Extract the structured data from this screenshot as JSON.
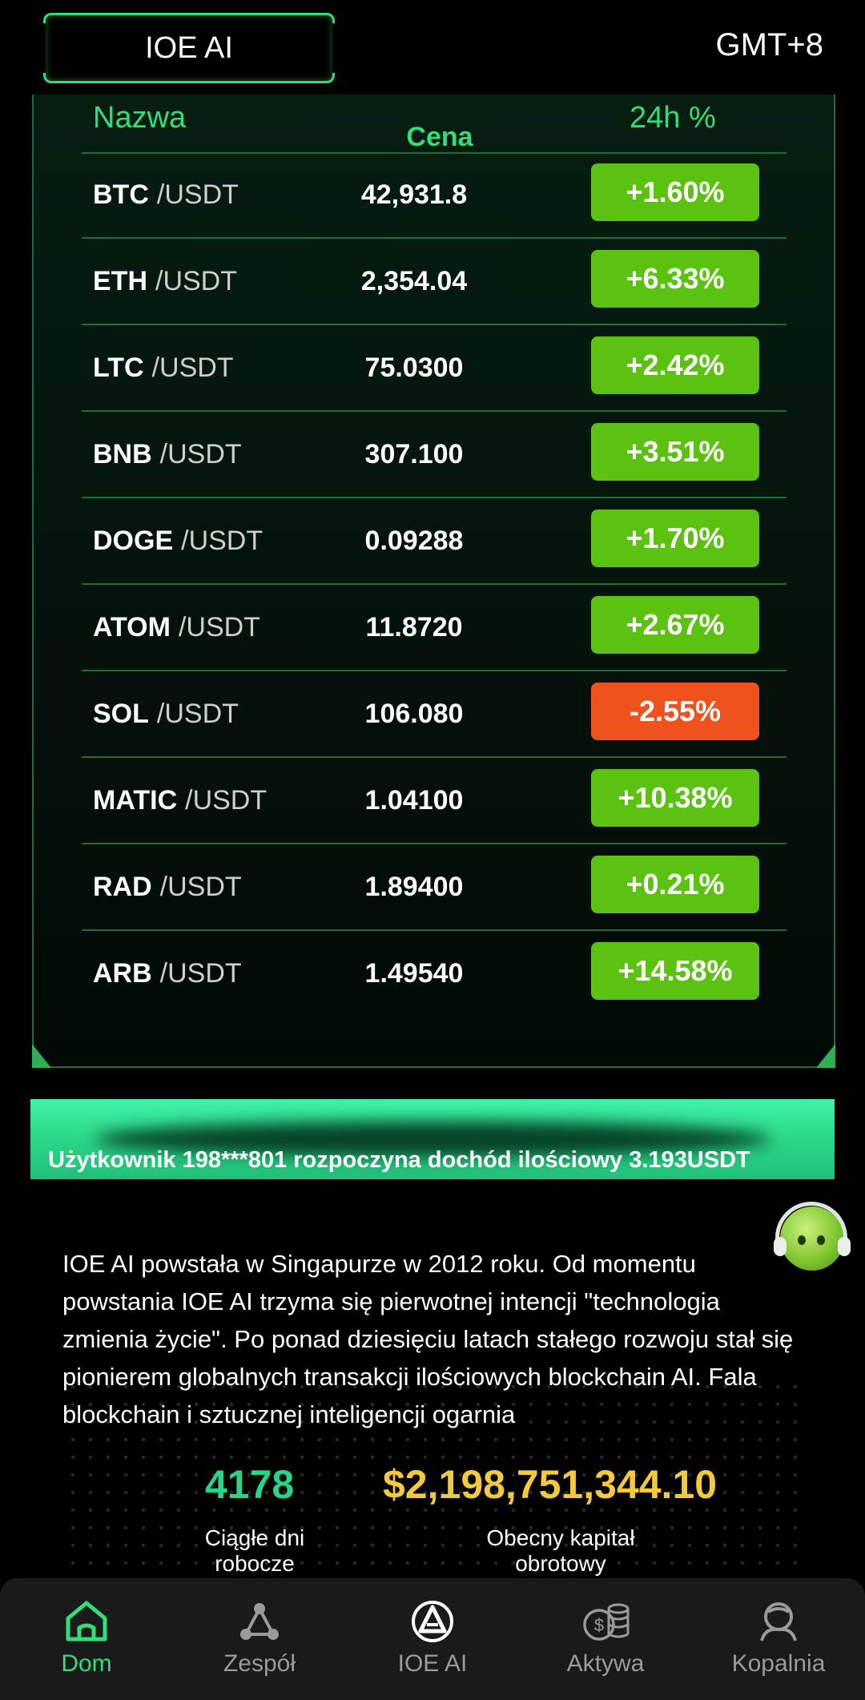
{
  "header": {
    "title": "IOE AI",
    "timezone": "GMT+8"
  },
  "market": {
    "columns": {
      "name": "Nazwa",
      "price": "Cena",
      "change": "24h %"
    },
    "rows": [
      {
        "symbol": "BTC",
        "quote": "/USDT",
        "price": "42,931.8",
        "change": "+1.60%",
        "direction": "up"
      },
      {
        "symbol": "ETH",
        "quote": "/USDT",
        "price": "2,354.04",
        "change": "+6.33%",
        "direction": "up"
      },
      {
        "symbol": "LTC",
        "quote": "/USDT",
        "price": "75.0300",
        "change": "+2.42%",
        "direction": "up"
      },
      {
        "symbol": "BNB",
        "quote": "/USDT",
        "price": "307.100",
        "change": "+3.51%",
        "direction": "up"
      },
      {
        "symbol": "DOGE",
        "quote": "/USDT",
        "price": "0.09288",
        "change": "+1.70%",
        "direction": "up"
      },
      {
        "symbol": "ATOM",
        "quote": "/USDT",
        "price": "11.8720",
        "change": "+2.67%",
        "direction": "up"
      },
      {
        "symbol": "SOL",
        "quote": "/USDT",
        "price": "106.080",
        "change": "-2.55%",
        "direction": "down"
      },
      {
        "symbol": "MATIC",
        "quote": "/USDT",
        "price": "1.04100",
        "change": "+10.38%",
        "direction": "up"
      },
      {
        "symbol": "RAD",
        "quote": "/USDT",
        "price": "1.89400",
        "change": "+0.21%",
        "direction": "up"
      },
      {
        "symbol": "ARB",
        "quote": "/USDT",
        "price": "1.49540",
        "change": "+14.58%",
        "direction": "up"
      }
    ]
  },
  "notice": {
    "text": "Użytkownik 198***801 rozpoczyna dochód ilościowy 3.193USDT"
  },
  "about": {
    "text": "IOE AI powstała w Singapurze w 2012 roku. Od momentu powstania IOE AI trzyma się pierwotnej intencji \"technologia zmienia życie\". Po ponad dziesięciu latach stałego rozwoju stał się pionierem globalnych transakcji ilościowych blockchain AI. Fala blockchain i sztucznej inteligencji ogarnia"
  },
  "stats": {
    "days": {
      "value": "4178",
      "label": "Ciągłe dni robocze"
    },
    "capital": {
      "value": "$2,198,751,344.10",
      "label": "Obecny kapitał obrotowy"
    }
  },
  "nav": [
    {
      "label": "Dom",
      "icon": "home-icon",
      "active": true
    },
    {
      "label": "Zespół",
      "icon": "team-icon",
      "active": false
    },
    {
      "label": "IOE AI",
      "icon": "ioe-logo-icon",
      "active": false
    },
    {
      "label": "Aktywa",
      "icon": "coins-icon",
      "active": false
    },
    {
      "label": "Kopalnia",
      "icon": "mine-icon",
      "active": false
    }
  ],
  "colors": {
    "accent": "#2fe07a",
    "up": "#5cc211",
    "down": "#f0521d",
    "gold": "#f3c93f"
  }
}
